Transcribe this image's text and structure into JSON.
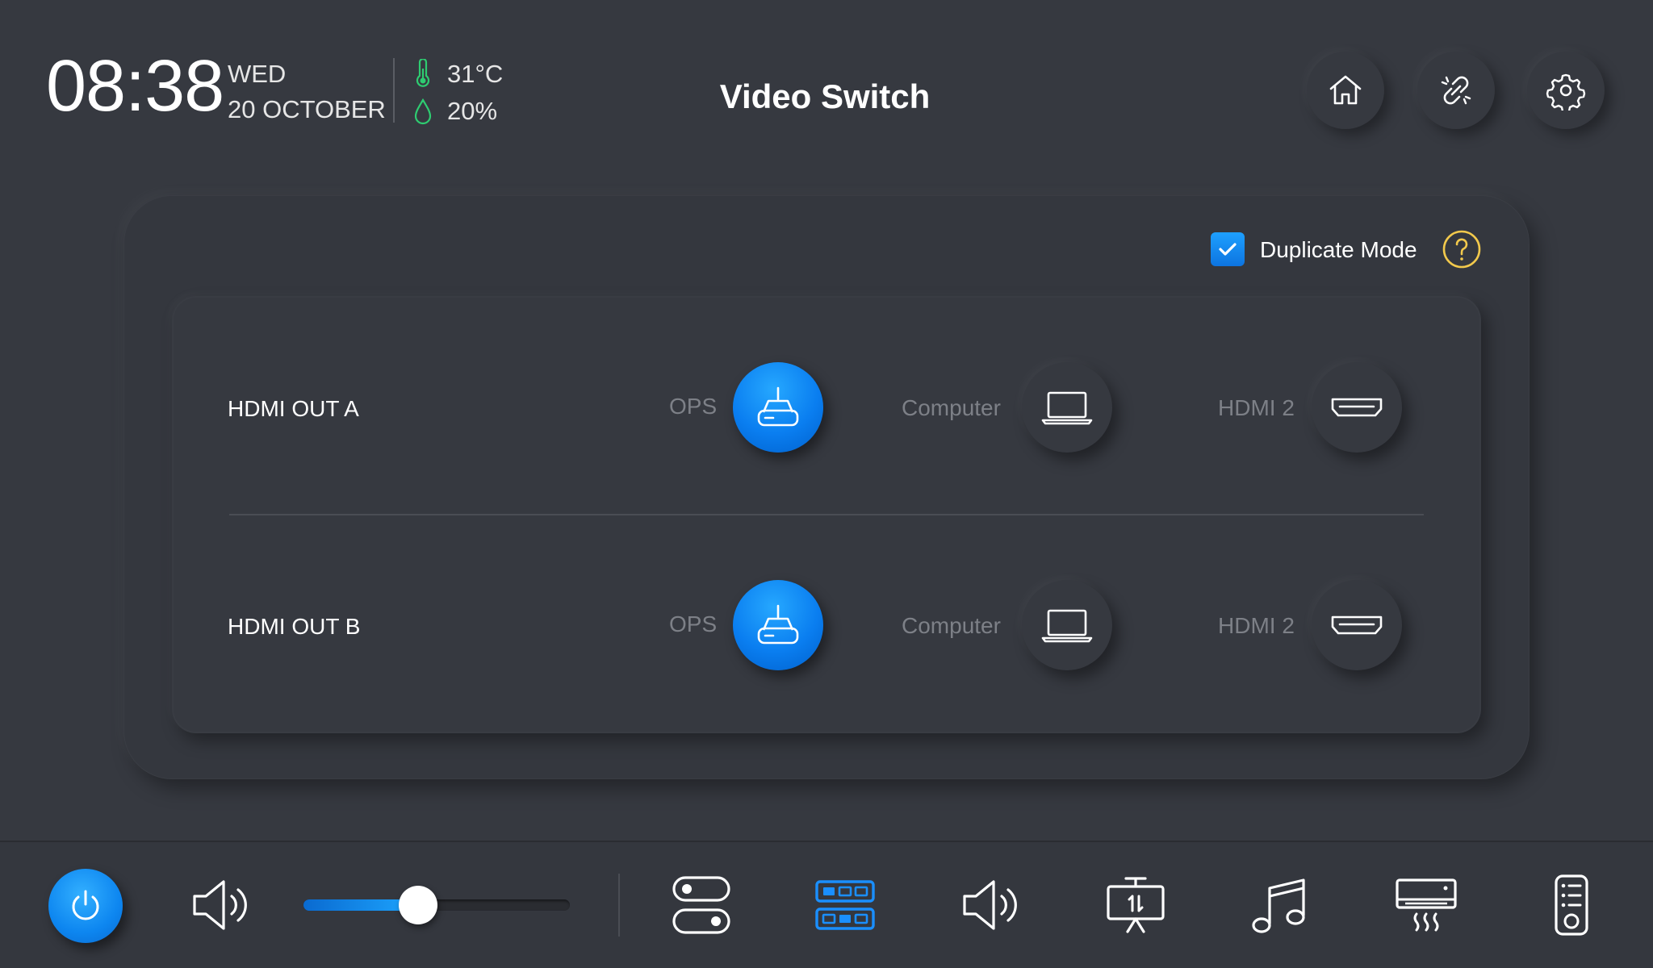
{
  "header": {
    "time": "08:38",
    "day": "WED",
    "date": "20 OCTOBER",
    "temperature": "31°C",
    "humidity": "20%",
    "title": "Video Switch",
    "buttons": [
      "home-icon",
      "link-broken-icon",
      "gear-icon"
    ]
  },
  "panel": {
    "duplicate_mode": {
      "label": "Duplicate Mode",
      "checked": true
    },
    "help_icon": "question-icon",
    "rows": [
      {
        "label": "HDMI OUT A",
        "sources": [
          {
            "label": "OPS",
            "icon": "ops-box-icon",
            "active": true
          },
          {
            "label": "Computer",
            "icon": "laptop-icon",
            "active": false
          },
          {
            "label": "HDMI 2",
            "icon": "hdmi-port-icon",
            "active": false
          }
        ]
      },
      {
        "label": "HDMI OUT B",
        "sources": [
          {
            "label": "OPS",
            "icon": "ops-box-icon",
            "active": true
          },
          {
            "label": "Computer",
            "icon": "laptop-icon",
            "active": false
          },
          {
            "label": "HDMI 2",
            "icon": "hdmi-port-icon",
            "active": false
          }
        ]
      }
    ]
  },
  "bottom_bar": {
    "volume_level": 0.43,
    "items": [
      "power-icon",
      "speaker-icon",
      "switches-icon",
      "video-matrix-icon",
      "audio-icon",
      "presentation-icon",
      "music-icon",
      "air-conditioner-icon",
      "remote-icon"
    ]
  },
  "colors": {
    "background": "#363940",
    "accent": "#0d86f0",
    "temperature": "#2ecc71",
    "help": "#f2c94c",
    "muted_text": "#7d8087"
  }
}
